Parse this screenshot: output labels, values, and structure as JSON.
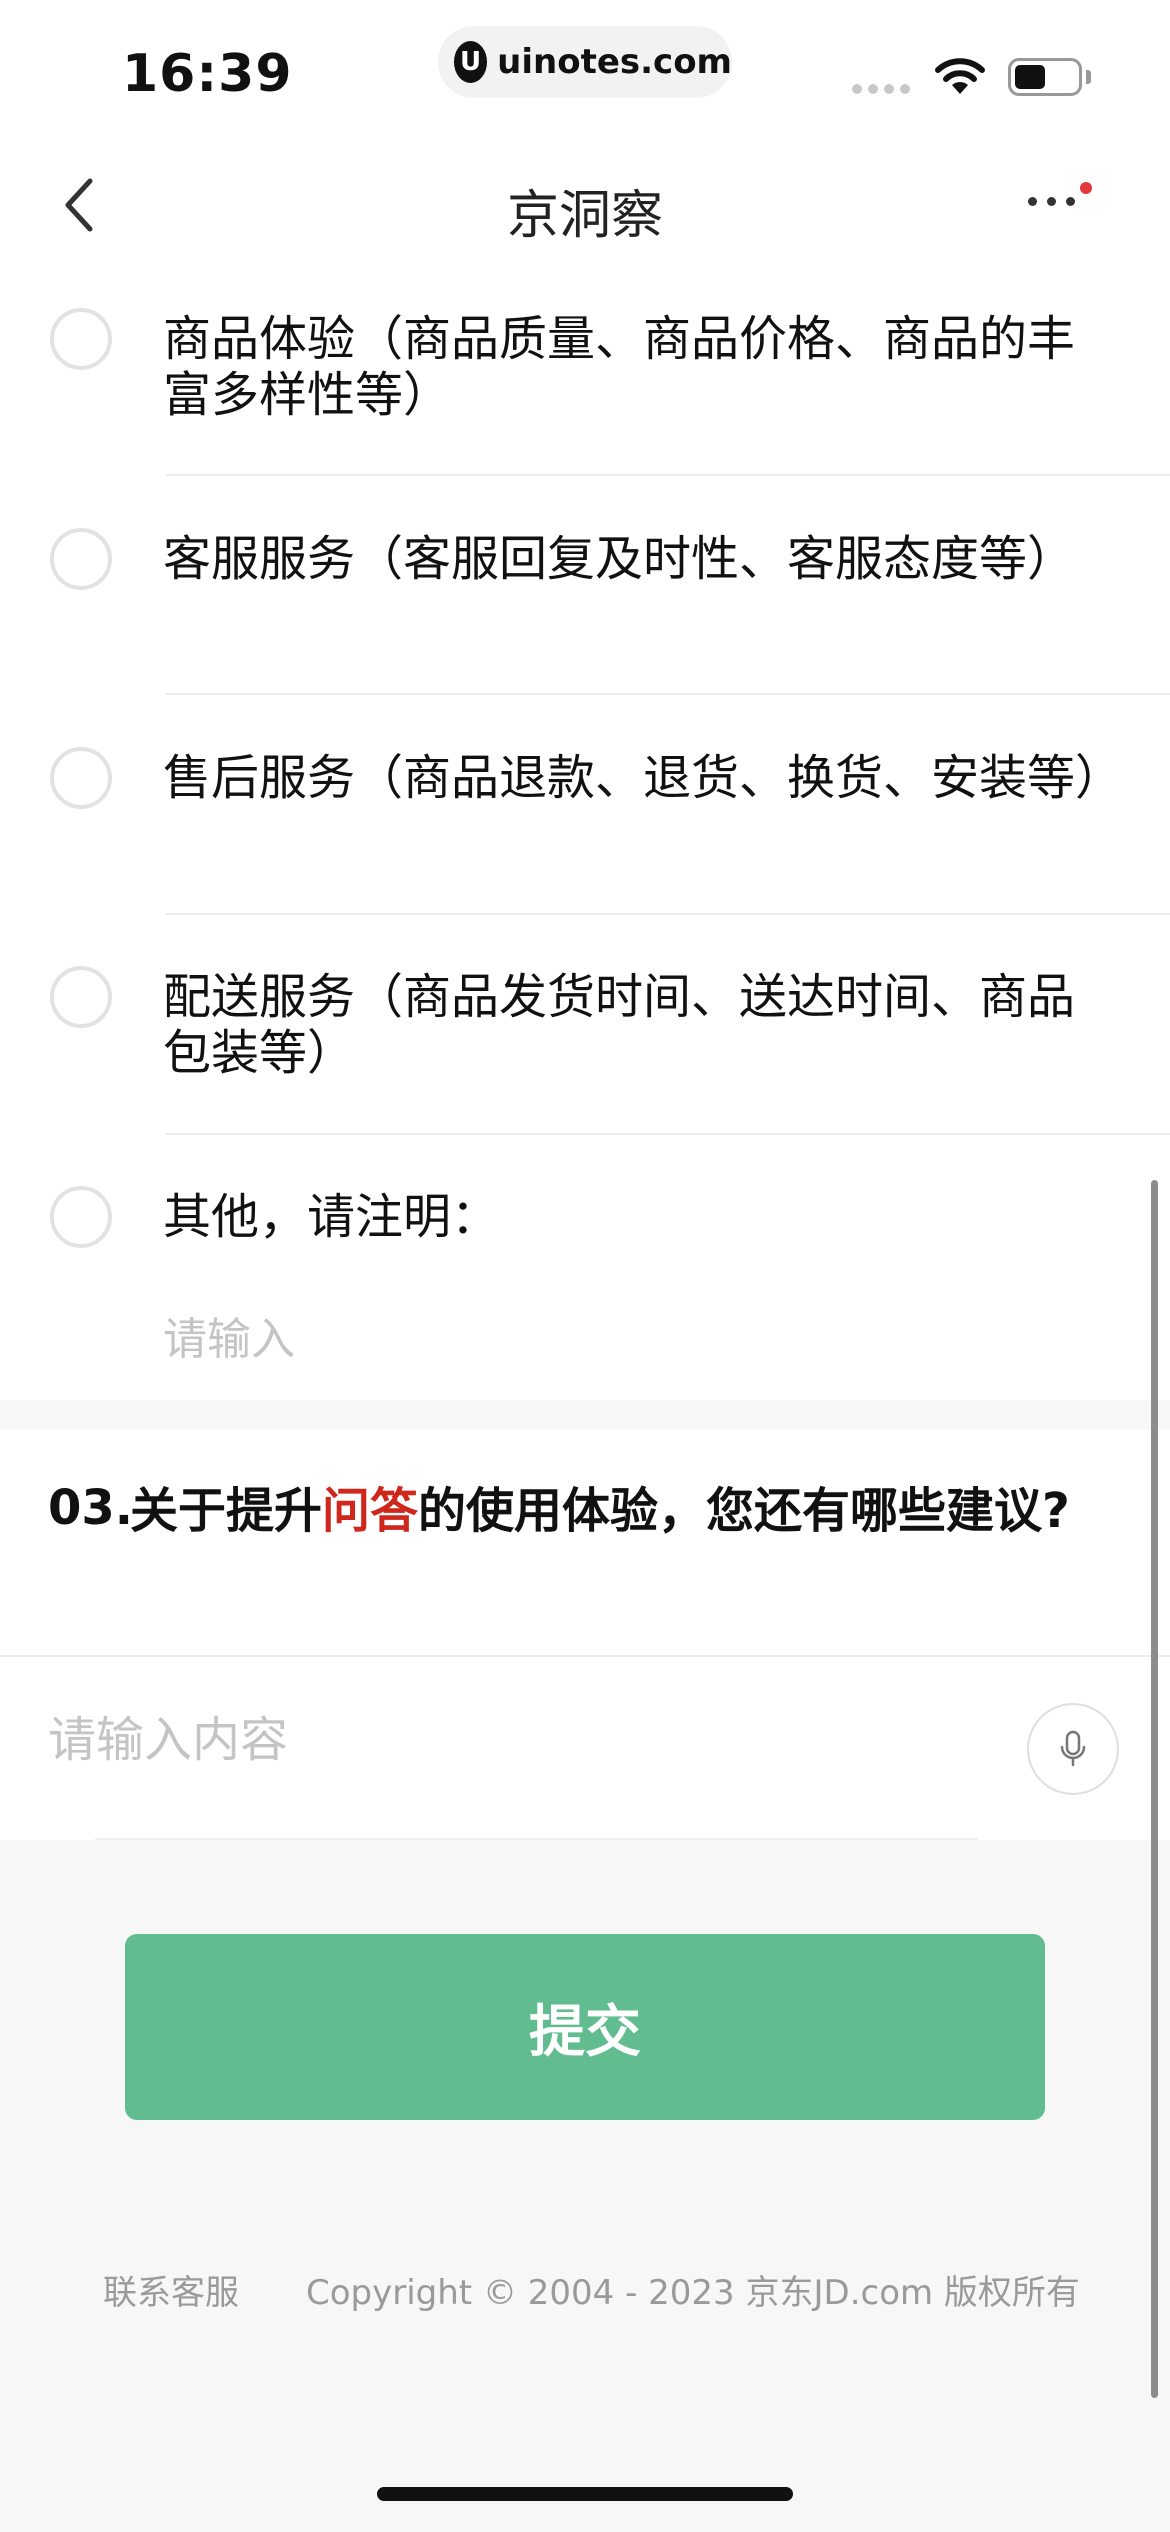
{
  "status_bar": {
    "time": "16:39",
    "url": "uinotes.com",
    "url_logo": "U"
  },
  "nav": {
    "title": "京洞察",
    "back_icon": "chevron-left-icon",
    "more_icon": "more-dots-icon",
    "badge_color": "#e4393c"
  },
  "options": {
    "items": [
      {
        "label": "商品体验（商品质量、商品价格、商品的丰富多样性等）"
      },
      {
        "label": "客服服务（客服回复及时性、客服态度等）"
      },
      {
        "label": "售后服务（商品退款、退货、换货、安装等）"
      },
      {
        "label": "配送服务（商品发货时间、送达时间、商品包装等）"
      },
      {
        "label": "其他，请注明："
      }
    ],
    "other_placeholder": "请输入"
  },
  "question3": {
    "number": "03.",
    "text_before": "关于提升",
    "text_highlight": "问答",
    "text_after": "的使用体验，您还有哪些建议?",
    "highlight_color": "#d0271d",
    "answer_placeholder": "请输入内容",
    "mic_icon": "microphone-icon"
  },
  "submit": {
    "label": "提交",
    "color": "#61bd90"
  },
  "footer": {
    "contact_label": "联系客服",
    "copyright": "Copyright © 2004 - 2023 京东JD.com 版权所有"
  }
}
